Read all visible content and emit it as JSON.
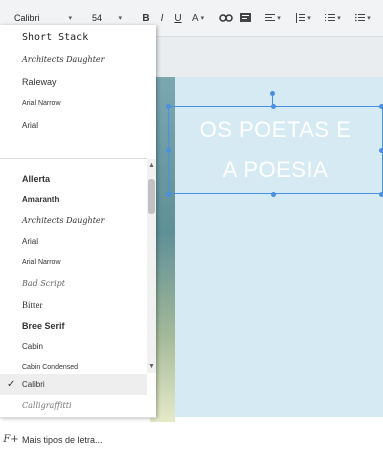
{
  "toolbar": {
    "font": "Calibri",
    "size": "54",
    "bold": "B",
    "italic": "I",
    "underline": "U",
    "text_color": "A",
    "link_icon": "link-icon",
    "comment_icon": "comment-icon",
    "align_icon": "align-icon",
    "spacing_icon": "line-spacing-icon",
    "numbered_list_icon": "numbered-list-icon",
    "bulleted_list_icon": "bulleted-list-icon"
  },
  "slide": {
    "text_line1": "OS POETAS E",
    "text_line2": "A POESIA"
  },
  "font_menu": {
    "recent": [
      "Short Stack",
      "Architects Daughter",
      "Raleway",
      "Arial Narrow",
      "Arial"
    ],
    "all": [
      "Allerta",
      "Amaranth",
      "Architects Daughter",
      "Arial",
      "Arial Narrow",
      "Bad Script",
      "Bitter",
      "Bree Serif",
      "Cabin",
      "Cabin Condensed",
      "Calibri",
      "Calligraffitti"
    ],
    "selected": "Calibri",
    "more_fonts": "Mais tipos de letra..."
  },
  "colors": {
    "selection": "#4a90e2",
    "slide_bg": "#d6eaf4"
  }
}
